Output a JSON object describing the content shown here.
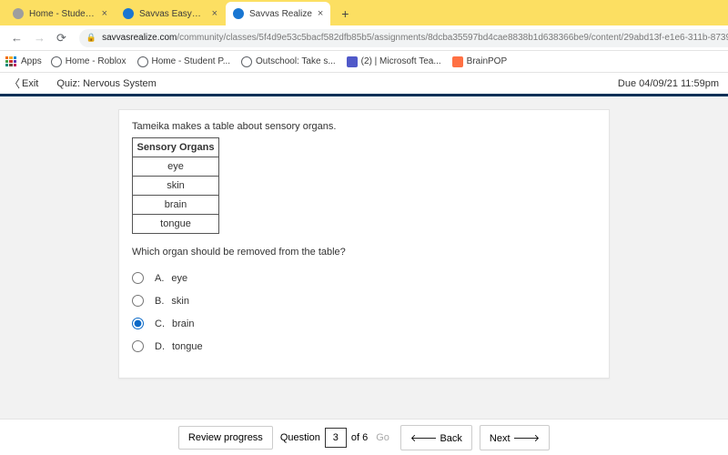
{
  "browser": {
    "tabs": [
      {
        "label": "Home - Student Portal",
        "fav_bg": "#9e9e9e"
      },
      {
        "label": "Savvas EasyBridge",
        "fav_bg": "#1976d2"
      },
      {
        "label": "Savvas Realize",
        "fav_bg": "#1976d2",
        "active": true
      }
    ],
    "url_domain": "savvasrealize.com",
    "url_path": "/community/classes/5f4d9e53c5bacf582dfb85b5/assignments/8dcba35597bd4cae8838b1d638366be9/content/29abd13f-e1e6-311b-8739-73bb4b4aac46/...",
    "avatar": "A",
    "apps_label": "Apps",
    "bookmarks": [
      {
        "label": "Home - Roblox",
        "icon": "globe"
      },
      {
        "label": "Home - Student P...",
        "icon": "globe"
      },
      {
        "label": "Outschool: Take s...",
        "icon": "globe"
      },
      {
        "label": "(2) | Microsoft Tea...",
        "icon": "teams"
      },
      {
        "label": "BrainPOP",
        "icon": "brainpop"
      }
    ]
  },
  "quiz": {
    "exit_label": "Exit",
    "title": "Quiz: Nervous System",
    "due": "Due 04/09/21 11:59pm",
    "prompt": "Tameika makes a table about sensory organs.",
    "table_header": "Sensory Organs",
    "table_rows": [
      "eye",
      "skin",
      "brain",
      "tongue"
    ],
    "question": "Which organ should be removed from the table?",
    "options": [
      {
        "letter": "A.",
        "text": "eye"
      },
      {
        "letter": "B.",
        "text": "skin"
      },
      {
        "letter": "C.",
        "text": "brain",
        "selected": true
      },
      {
        "letter": "D.",
        "text": "tongue"
      }
    ]
  },
  "footer": {
    "review": "Review progress",
    "question_label": "Question",
    "question_value": "3",
    "of_label": "of 6",
    "go": "Go",
    "back": "Back",
    "next": "Next"
  }
}
